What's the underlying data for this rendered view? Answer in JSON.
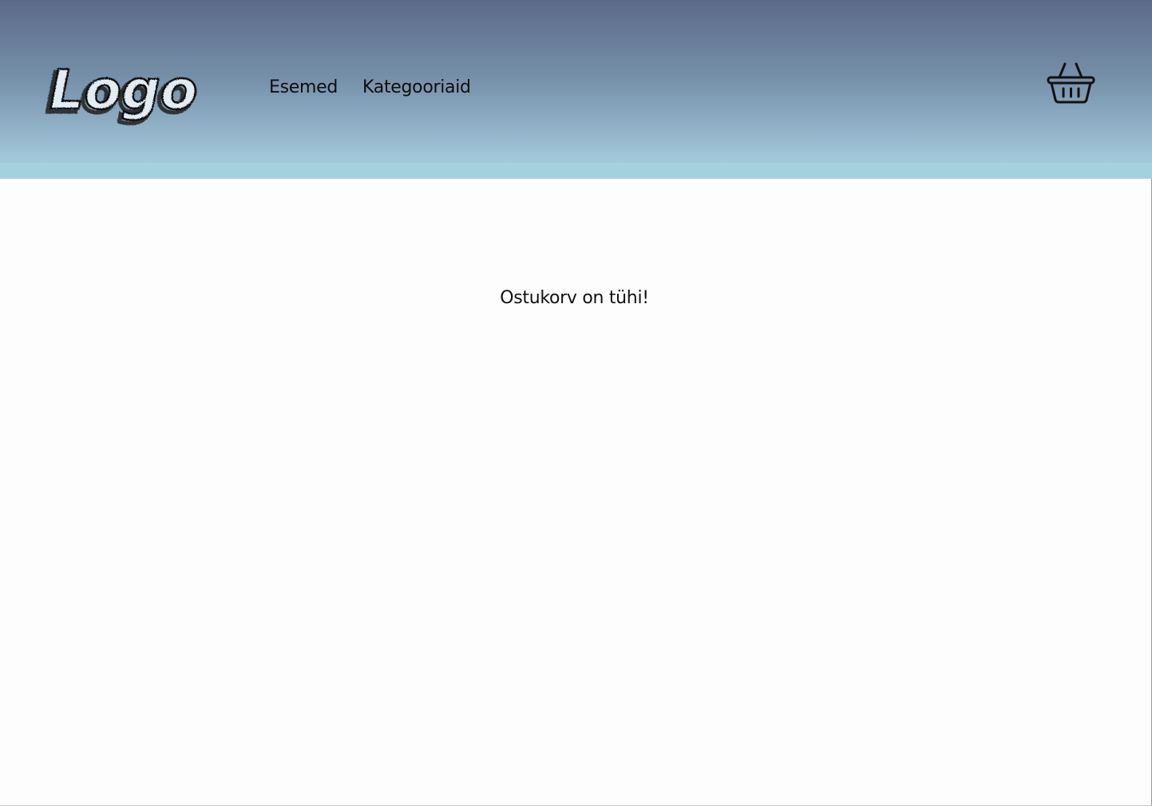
{
  "header": {
    "logo_text": "Logo",
    "nav": [
      {
        "label": "Esemed"
      },
      {
        "label": "Kategooriaid"
      }
    ],
    "cart_icon": "basket-icon"
  },
  "main": {
    "empty_message": "Ostukorv on tühi!"
  },
  "colors": {
    "header_top": "#5b6a88",
    "header_bottom": "#a6d1df",
    "background": "#fdfdfd",
    "text": "#111111"
  }
}
